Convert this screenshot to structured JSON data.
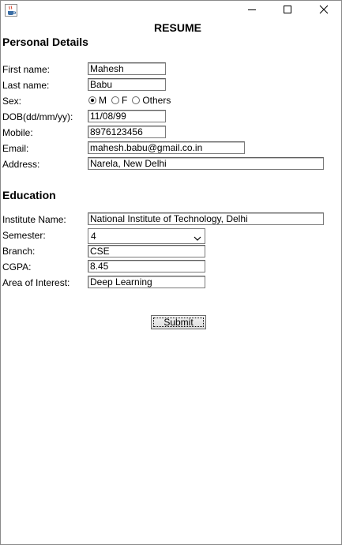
{
  "window": {
    "title": ""
  },
  "form": {
    "title": "RESUME",
    "personal": {
      "heading": "Personal Details",
      "first_name_label": "First name:",
      "first_name": "Mahesh",
      "last_name_label": "Last name:",
      "last_name": "Babu",
      "sex_label": "Sex:",
      "sex_options": [
        "M",
        "F",
        "Others"
      ],
      "sex_selected": "M",
      "dob_label": "DOB(dd/mm/yy):",
      "dob": "11/08/99",
      "mobile_label": "Mobile:",
      "mobile": "8976123456",
      "email_label": "Email:",
      "email": "mahesh.babu@gmail.co.in",
      "address_label": "Address:",
      "address": "Narela, New Delhi"
    },
    "education": {
      "heading": "Education",
      "institute_label": "Institute Name:",
      "institute": "National Institute of Technology, Delhi",
      "semester_label": "Semester:",
      "semester": "4",
      "branch_label": "Branch:",
      "branch": "CSE",
      "cgpa_label": "CGPA:",
      "cgpa": "8.45",
      "interest_label": "Area of Interest:",
      "interest": "Deep Learning"
    },
    "submit_label": "Submit"
  },
  "icons": {
    "app": "java-coffee-cup-icon",
    "minimize": "minimize-icon",
    "maximize": "maximize-icon",
    "close": "close-icon",
    "dropdown": "chevron-down-icon"
  }
}
